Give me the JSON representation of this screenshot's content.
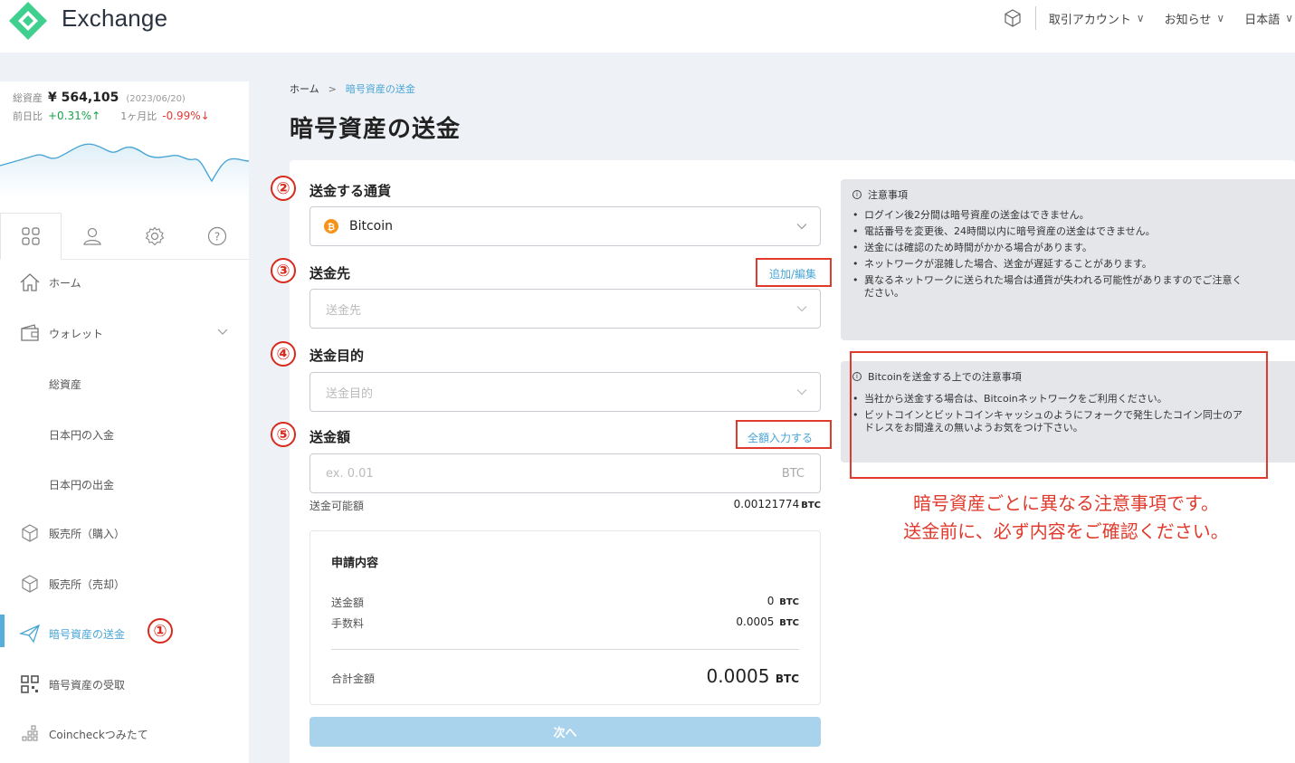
{
  "header": {
    "brand": "Exchange",
    "menu": [
      "取引アカウント",
      "お知らせ",
      "日本語"
    ]
  },
  "sidebar": {
    "total_label": "総資産",
    "total_value": "¥ 564,105",
    "total_date": "(2023/06/20)",
    "day_label": "前日比",
    "day_change": "+0.31%↑",
    "month_label": "1ヶ月比",
    "month_change": "-0.99%↓",
    "nav": [
      {
        "label": "ホーム"
      },
      {
        "label": "ウォレット"
      },
      {
        "label": "総資産"
      },
      {
        "label": "日本円の入金"
      },
      {
        "label": "日本円の出金"
      },
      {
        "label": "販売所（購入）"
      },
      {
        "label": "販売所（売却）"
      },
      {
        "label": "暗号資産の送金"
      },
      {
        "label": "暗号資産の受取"
      },
      {
        "label": "Coincheckつみたて"
      }
    ]
  },
  "breadcrumb": {
    "home": "ホーム",
    "sep": ">",
    "current": "暗号資産の送金"
  },
  "page_title": "暗号資産の送金",
  "steps": [
    "①",
    "②",
    "③",
    "④",
    "⑤"
  ],
  "form": {
    "currency_label": "送金する通貨",
    "currency_value": "Bitcoin",
    "dest_label": "送金先",
    "dest_link": "追加/編集",
    "dest_placeholder": "送金先",
    "purpose_label": "送金目的",
    "purpose_placeholder": "送金目的",
    "amount_label": "送金額",
    "amount_link": "全額入力する",
    "amount_placeholder": "ex. 0.01",
    "amount_unit": "BTC",
    "available_label": "送金可能額",
    "available_value": "0.00121774",
    "available_unit": "BTC"
  },
  "summary": {
    "title": "申請内容",
    "amount_label": "送金額",
    "amount_value": "0",
    "fee_label": "手数料",
    "fee_value": "0.0005",
    "total_label": "合計金額",
    "total_value": "0.0005",
    "unit": "BTC"
  },
  "next_button": "次へ",
  "notice1": {
    "title": "注意事項",
    "items": [
      "ログイン後2分間は暗号資産の送金はできません。",
      "電話番号を変更後、24時間以内に暗号資産の送金はできません。",
      "送金には確認のため時間がかかる場合があります。",
      "ネットワークが混雑した場合、送金が遅延することがあります。",
      "異なるネットワークに送られた場合は通貨が失われる可能性がありますのでご注意ください。"
    ]
  },
  "notice2": {
    "title": "Bitcoinを送金する上での注意事項",
    "items": [
      "当社から送金する場合は、Bitcoinネットワークをご利用ください。",
      "ビットコインとビットコインキャッシュのようにフォークで発生したコイン同士のアドレスをお間違えの無いようお気をつけ下さい。"
    ]
  },
  "caption": {
    "line1": "暗号資産ごとに異なる注意事項です。",
    "line2": "送金前に、必ず内容をご確認ください。"
  },
  "colors": {
    "accent": "#4aa6d6",
    "annotation_red": "#e03a2c",
    "logo_green": "#3fcf8e",
    "button_disabled": "#a9d3ed"
  }
}
